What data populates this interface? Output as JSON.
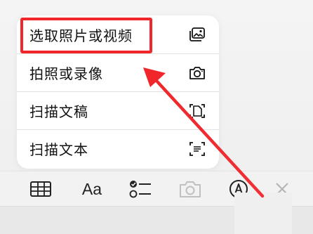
{
  "menu": {
    "items": [
      {
        "label": "选取照片或视频",
        "icon": "photo-library-icon"
      },
      {
        "label": "拍照或录像",
        "icon": "camera-icon"
      },
      {
        "label": "扫描文稿",
        "icon": "scan-document-icon"
      },
      {
        "label": "扫描文本",
        "icon": "scan-text-icon"
      }
    ]
  },
  "toolbar": {
    "format_label": "Aa",
    "buttons": [
      "table-icon",
      "text-format-icon",
      "checklist-icon",
      "camera-icon",
      "markup-pen-icon",
      "close-icon"
    ]
  },
  "annotation": {
    "color": "#f0262b"
  }
}
